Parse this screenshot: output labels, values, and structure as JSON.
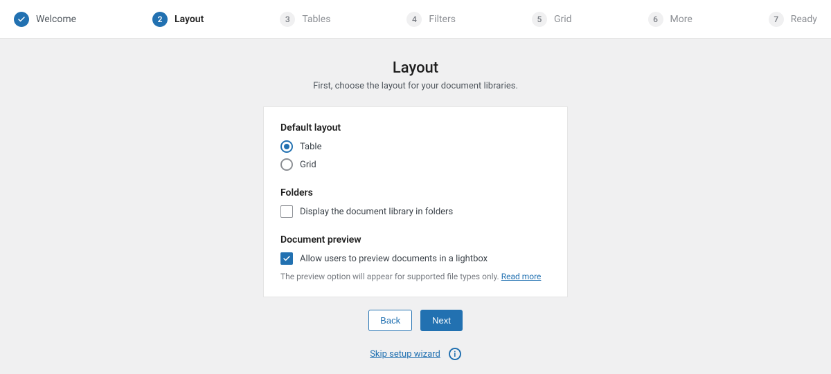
{
  "stepper": [
    {
      "label": "Welcome",
      "state": "done",
      "num": ""
    },
    {
      "label": "Layout",
      "state": "active",
      "num": "2"
    },
    {
      "label": "Tables",
      "state": "pending",
      "num": "3"
    },
    {
      "label": "Filters",
      "state": "pending",
      "num": "4"
    },
    {
      "label": "Grid",
      "state": "pending",
      "num": "5"
    },
    {
      "label": "More",
      "state": "pending",
      "num": "6"
    },
    {
      "label": "Ready",
      "state": "pending",
      "num": "7"
    }
  ],
  "page": {
    "title": "Layout",
    "subtitle": "First, choose the layout for your document libraries."
  },
  "defaultLayout": {
    "heading": "Default layout",
    "options": {
      "table": "Table",
      "grid": "Grid"
    },
    "selected": "table"
  },
  "folders": {
    "heading": "Folders",
    "checkboxLabel": "Display the document library in folders",
    "checked": false
  },
  "preview": {
    "heading": "Document preview",
    "checkboxLabel": "Allow users to preview documents in a lightbox",
    "checked": true,
    "hint": "The preview option will appear for supported file types only. ",
    "readMore": "Read more"
  },
  "buttons": {
    "back": "Back",
    "next": "Next"
  },
  "footer": {
    "skip": "Skip setup wizard"
  }
}
